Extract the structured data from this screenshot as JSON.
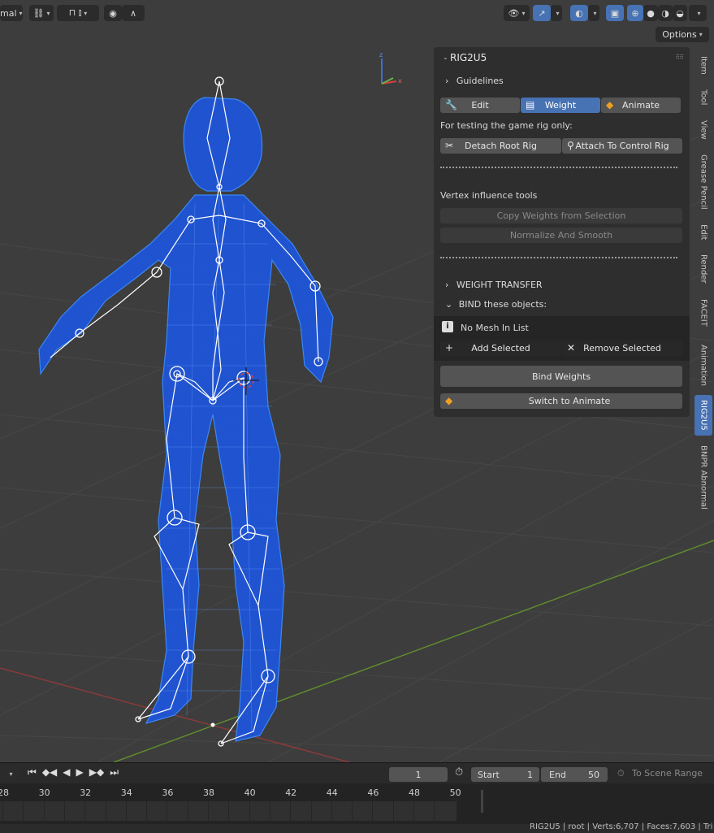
{
  "header": {
    "mode_fragment": "mal",
    "options_label": "Options"
  },
  "panel": {
    "title": "RIG2U5",
    "guidelines": "Guidelines",
    "modes": [
      "Edit",
      "Weight",
      "Animate"
    ],
    "testing_label": "For testing the game rig only:",
    "detach_label": "Detach Root Rig",
    "attach_label": "Attach To Control Rig",
    "vertex_label": "Vertex influence tools",
    "copy_weights": "Copy Weights from Selection",
    "normalize": "Normalize And Smooth",
    "weight_transfer": "WEIGHT TRANSFER",
    "bind_objects": "BIND these objects:",
    "no_mesh": "No Mesh In List",
    "add_selected": "Add Selected",
    "remove_selected": "Remove Selected",
    "bind_weights": "Bind Weights",
    "switch_animate": "Switch to Animate"
  },
  "tabs": [
    "Item",
    "Tool",
    "View",
    "Grease Pencil",
    "Edit",
    "Render",
    "FACEIT",
    "Animation",
    "RIG2U5",
    "BNPR Abnormal"
  ],
  "timeline": {
    "current_frame": "1",
    "start_label": "Start",
    "start_value": "1",
    "end_label": "End",
    "end_value": "50",
    "scene_range": "To Scene Range",
    "ticks": [
      "28",
      "30",
      "32",
      "34",
      "36",
      "38",
      "40",
      "42",
      "44",
      "46",
      "48",
      "50"
    ]
  },
  "status": {
    "text": "RIG2U5 | root | Verts:6,707 | Faces:7,603 | Tri"
  },
  "colors": {
    "accent": "#4772b3",
    "wire": "#1f6fff",
    "bone": "#ffffff"
  }
}
